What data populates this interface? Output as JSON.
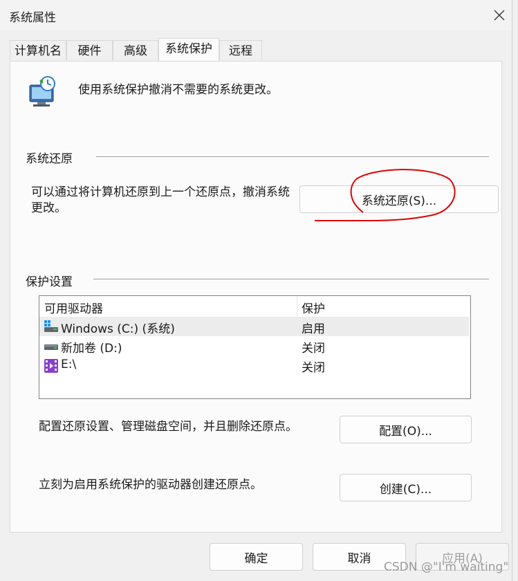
{
  "window": {
    "title": "系统属性"
  },
  "tabs": [
    {
      "label": "计算机名"
    },
    {
      "label": "硬件"
    },
    {
      "label": "高级"
    },
    {
      "label": "系统保护"
    },
    {
      "label": "远程"
    }
  ],
  "active_tab": "系统保护",
  "intro": {
    "text": "使用系统保护撤消不需要的系统更改。",
    "icon": "system-protection-icon"
  },
  "restore_group": {
    "title": "系统还原",
    "description": "可以通过将计算机还原到上一个还原点，撤消系统更改。",
    "button_label": "系统还原(S)...",
    "annotation_color": "#e00000"
  },
  "protection_group": {
    "title": "保护设置",
    "columns": [
      "可用驱动器",
      "保护"
    ],
    "drives": [
      {
        "name": "Windows (C:) (系统)",
        "protection": "启用",
        "icon": "windows-drive-icon"
      },
      {
        "name": "新加卷 (D:)",
        "protection": "关闭",
        "icon": "hard-drive-icon"
      },
      {
        "name": "E:\\",
        "protection": "关闭",
        "icon": "media-drive-icon"
      }
    ],
    "configure_text": "配置还原设置、管理磁盘空间，并且删除还原点。",
    "configure_button": "配置(O)...",
    "create_text": "立刻为启用系统保护的驱动器创建还原点。",
    "create_button": "创建(C)..."
  },
  "footer": {
    "ok": "确定",
    "cancel": "取消",
    "apply": "应用(A)"
  },
  "watermark": "CSDN @\"I'm waiting\""
}
